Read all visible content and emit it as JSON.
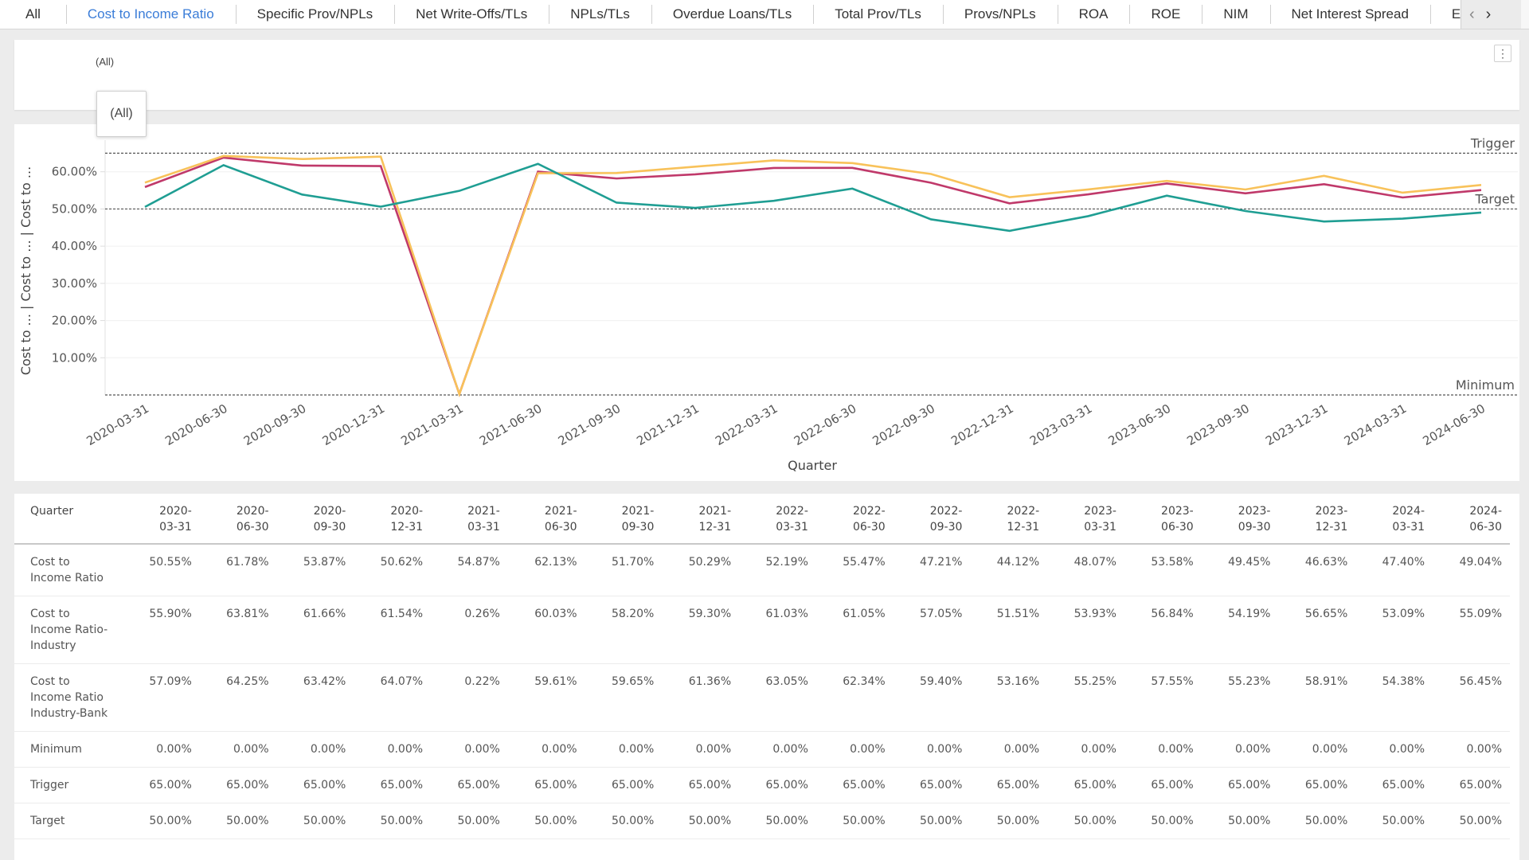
{
  "tabs": [
    {
      "label": "All",
      "active": false
    },
    {
      "label": "Cost to Income Ratio",
      "active": true
    },
    {
      "label": "Specific Prov/NPLs",
      "active": false
    },
    {
      "label": "Net Write-Offs/TLs",
      "active": false
    },
    {
      "label": "NPLs/TLs",
      "active": false
    },
    {
      "label": "Overdue Loans/TLs",
      "active": false
    },
    {
      "label": "Total Prov/TLs",
      "active": false
    },
    {
      "label": "Provs/NPLs",
      "active": false
    },
    {
      "label": "ROA",
      "active": false
    },
    {
      "label": "ROE",
      "active": false
    },
    {
      "label": "NIM",
      "active": false
    },
    {
      "label": "Net Interest Spread",
      "active": false
    },
    {
      "label": "E",
      "active": false
    }
  ],
  "tab_nav": {
    "prev": "‹",
    "next": "›"
  },
  "filter": {
    "value": "(All)",
    "popup_value": "(All)",
    "menu_icon": "⋮"
  },
  "chart_data": {
    "type": "line",
    "title": "",
    "xlabel": "Quarter",
    "ylabel_parts": [
      "Cost to ...",
      "Cost to ...",
      "Cost to ..."
    ],
    "ylim": [
      0,
      70
    ],
    "yticks": [
      10,
      20,
      30,
      40,
      50,
      60
    ],
    "ytick_labels": [
      "10.00%",
      "20.00%",
      "30.00%",
      "40.00%",
      "50.00%",
      "60.00%"
    ],
    "grid": true,
    "categories": [
      "2020-03-31",
      "2020-06-30",
      "2020-09-30",
      "2020-12-31",
      "2021-03-31",
      "2021-06-30",
      "2021-09-30",
      "2021-12-31",
      "2022-03-31",
      "2022-06-30",
      "2022-09-30",
      "2022-12-31",
      "2023-03-31",
      "2023-06-30",
      "2023-09-30",
      "2023-12-31",
      "2024-03-31",
      "2024-06-30"
    ],
    "series": [
      {
        "name": "Cost to Income Ratio",
        "color": "#1f9e93",
        "values": [
          50.55,
          61.78,
          53.87,
          50.62,
          54.87,
          62.13,
          51.7,
          50.29,
          52.19,
          55.47,
          47.21,
          44.12,
          48.07,
          53.58,
          49.45,
          46.63,
          47.4,
          49.04
        ]
      },
      {
        "name": "Cost to Income Ratio-Industry",
        "color": "#c0396a",
        "values": [
          55.9,
          63.81,
          61.66,
          61.54,
          0.26,
          60.03,
          58.2,
          59.3,
          61.03,
          61.05,
          57.05,
          51.51,
          53.93,
          56.84,
          54.19,
          56.65,
          53.09,
          55.09
        ]
      },
      {
        "name": "Cost to Income Ratio Industry-Bank",
        "color": "#f8c25a",
        "values": [
          57.09,
          64.25,
          63.42,
          64.07,
          0.22,
          59.61,
          59.65,
          61.36,
          63.05,
          62.34,
          59.4,
          53.16,
          55.25,
          57.55,
          55.23,
          58.91,
          54.38,
          56.45
        ]
      }
    ],
    "reference_lines": [
      {
        "name": "Trigger",
        "value": 65
      },
      {
        "name": "Target",
        "value": 50
      },
      {
        "name": "Minimum",
        "value": 0
      }
    ]
  },
  "table": {
    "header_label": "Quarter",
    "columns": [
      [
        "2020-",
        "03-31"
      ],
      [
        "2020-",
        "06-30"
      ],
      [
        "2020-",
        "09-30"
      ],
      [
        "2020-",
        "12-31"
      ],
      [
        "2021-",
        "03-31"
      ],
      [
        "2021-",
        "06-30"
      ],
      [
        "2021-",
        "09-30"
      ],
      [
        "2021-",
        "12-31"
      ],
      [
        "2022-",
        "03-31"
      ],
      [
        "2022-",
        "06-30"
      ],
      [
        "2022-",
        "09-30"
      ],
      [
        "2022-",
        "12-31"
      ],
      [
        "2023-",
        "03-31"
      ],
      [
        "2023-",
        "06-30"
      ],
      [
        "2023-",
        "09-30"
      ],
      [
        "2023-",
        "12-31"
      ],
      [
        "2024-",
        "03-31"
      ],
      [
        "2024-",
        "06-30"
      ]
    ],
    "rows": [
      {
        "label": [
          "Cost to",
          "Income Ratio"
        ],
        "cells": [
          "50.55%",
          "61.78%",
          "53.87%",
          "50.62%",
          "54.87%",
          "62.13%",
          "51.70%",
          "50.29%",
          "52.19%",
          "55.47%",
          "47.21%",
          "44.12%",
          "48.07%",
          "53.58%",
          "49.45%",
          "46.63%",
          "47.40%",
          "49.04%"
        ]
      },
      {
        "label": [
          "Cost to",
          "Income Ratio-",
          "Industry"
        ],
        "cells": [
          "55.90%",
          "63.81%",
          "61.66%",
          "61.54%",
          "0.26%",
          "60.03%",
          "58.20%",
          "59.30%",
          "61.03%",
          "61.05%",
          "57.05%",
          "51.51%",
          "53.93%",
          "56.84%",
          "54.19%",
          "56.65%",
          "53.09%",
          "55.09%"
        ]
      },
      {
        "label": [
          "Cost to",
          "Income Ratio",
          "Industry-Bank"
        ],
        "cells": [
          "57.09%",
          "64.25%",
          "63.42%",
          "64.07%",
          "0.22%",
          "59.61%",
          "59.65%",
          "61.36%",
          "63.05%",
          "62.34%",
          "59.40%",
          "53.16%",
          "55.25%",
          "57.55%",
          "55.23%",
          "58.91%",
          "54.38%",
          "56.45%"
        ]
      },
      {
        "label": [
          "Minimum"
        ],
        "cells": [
          "0.00%",
          "0.00%",
          "0.00%",
          "0.00%",
          "0.00%",
          "0.00%",
          "0.00%",
          "0.00%",
          "0.00%",
          "0.00%",
          "0.00%",
          "0.00%",
          "0.00%",
          "0.00%",
          "0.00%",
          "0.00%",
          "0.00%",
          "0.00%"
        ]
      },
      {
        "label": [
          "Trigger"
        ],
        "cells": [
          "65.00%",
          "65.00%",
          "65.00%",
          "65.00%",
          "65.00%",
          "65.00%",
          "65.00%",
          "65.00%",
          "65.00%",
          "65.00%",
          "65.00%",
          "65.00%",
          "65.00%",
          "65.00%",
          "65.00%",
          "65.00%",
          "65.00%",
          "65.00%"
        ]
      },
      {
        "label": [
          "Target"
        ],
        "cells": [
          "50.00%",
          "50.00%",
          "50.00%",
          "50.00%",
          "50.00%",
          "50.00%",
          "50.00%",
          "50.00%",
          "50.00%",
          "50.00%",
          "50.00%",
          "50.00%",
          "50.00%",
          "50.00%",
          "50.00%",
          "50.00%",
          "50.00%",
          "50.00%"
        ]
      }
    ]
  }
}
